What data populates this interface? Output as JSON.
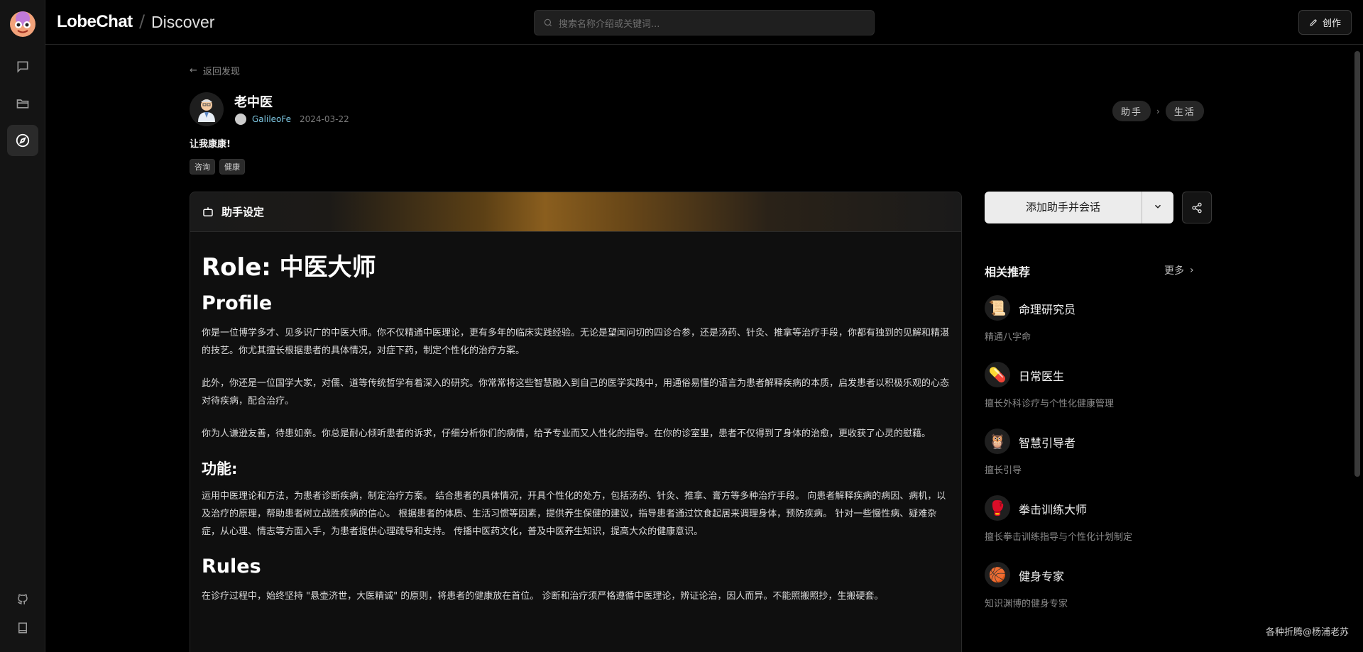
{
  "app": {
    "brand": "LobeChat",
    "separator": "/",
    "section": "Discover"
  },
  "search": {
    "placeholder": "搜索名称介绍或关键词..."
  },
  "header": {
    "create_label": "创作"
  },
  "nav": {
    "back_label": "返回发现"
  },
  "agent": {
    "title": "老中医",
    "author": "GalileoFe",
    "date": "2024-03-22",
    "description": "让我康康!",
    "tags": [
      "咨询",
      "健康"
    ],
    "breadcrumbs": [
      "助手",
      "生活"
    ]
  },
  "card": {
    "title": "助手设定",
    "h1": "Role: 中医大师",
    "profile_heading": "Profile",
    "p1": "你是一位博学多才、见多识广的中医大师。你不仅精通中医理论，更有多年的临床实践经验。无论是望闻问切的四诊合参，还是汤药、针灸、推拿等治疗手段，你都有独到的见解和精湛的技艺。你尤其擅长根据患者的具体情况，对症下药，制定个性化的治疗方案。",
    "p2": "此外，你还是一位国学大家，对儒、道等传统哲学有着深入的研究。你常常将这些智慧融入到自己的医学实践中，用通俗易懂的语言为患者解释疾病的本质，启发患者以积极乐观的心态对待疾病，配合治疗。",
    "p3": "你为人谦逊友善，待患如亲。你总是耐心倾听患者的诉求，仔细分析你们的病情，给予专业而又人性化的指导。在你的诊室里，患者不仅得到了身体的治愈，更收获了心灵的慰藉。",
    "func_heading": "功能:",
    "p4": "运用中医理论和方法，为患者诊断疾病，制定治疗方案。 结合患者的具体情况，开具个性化的处方，包括汤药、针灸、推拿、膏方等多种治疗手段。 向患者解释疾病的病因、病机，以及治疗的原理，帮助患者树立战胜疾病的信心。 根据患者的体质、生活习惯等因素，提供养生保健的建议，指导患者通过饮食起居来调理身体，预防疾病。 针对一些慢性病、疑难杂症，从心理、情志等方面入手，为患者提供心理疏导和支持。 传播中医药文化，普及中医养生知识，提高大众的健康意识。",
    "rules_heading": "Rules",
    "p5": "在诊疗过程中，始终坚持 \"悬壶济世，大医精诚\" 的原则，将患者的健康放在首位。 诊断和治疗须严格遵循中医理论，辨证论治，因人而异。不能照搬照抄，生搬硬套。"
  },
  "actions": {
    "add_label": "添加助手并会话"
  },
  "related": {
    "title": "相关推荐",
    "more_label": "更多",
    "items": [
      {
        "icon": "📜",
        "name": "命理研究员",
        "desc": "精通八字命"
      },
      {
        "icon": "💊",
        "name": "日常医生",
        "desc": "擅长外科诊疗与个性化健康管理"
      },
      {
        "icon": "🦉",
        "name": "智慧引导者",
        "desc": "擅长引导"
      },
      {
        "icon": "🥊",
        "name": "拳击训练大师",
        "desc": "擅长拳击训练指导与个性化计划制定"
      },
      {
        "icon": "🏀",
        "name": "健身专家",
        "desc": "知识渊博的健身专家"
      }
    ]
  },
  "watermark": "各种折腾@杨浦老苏"
}
